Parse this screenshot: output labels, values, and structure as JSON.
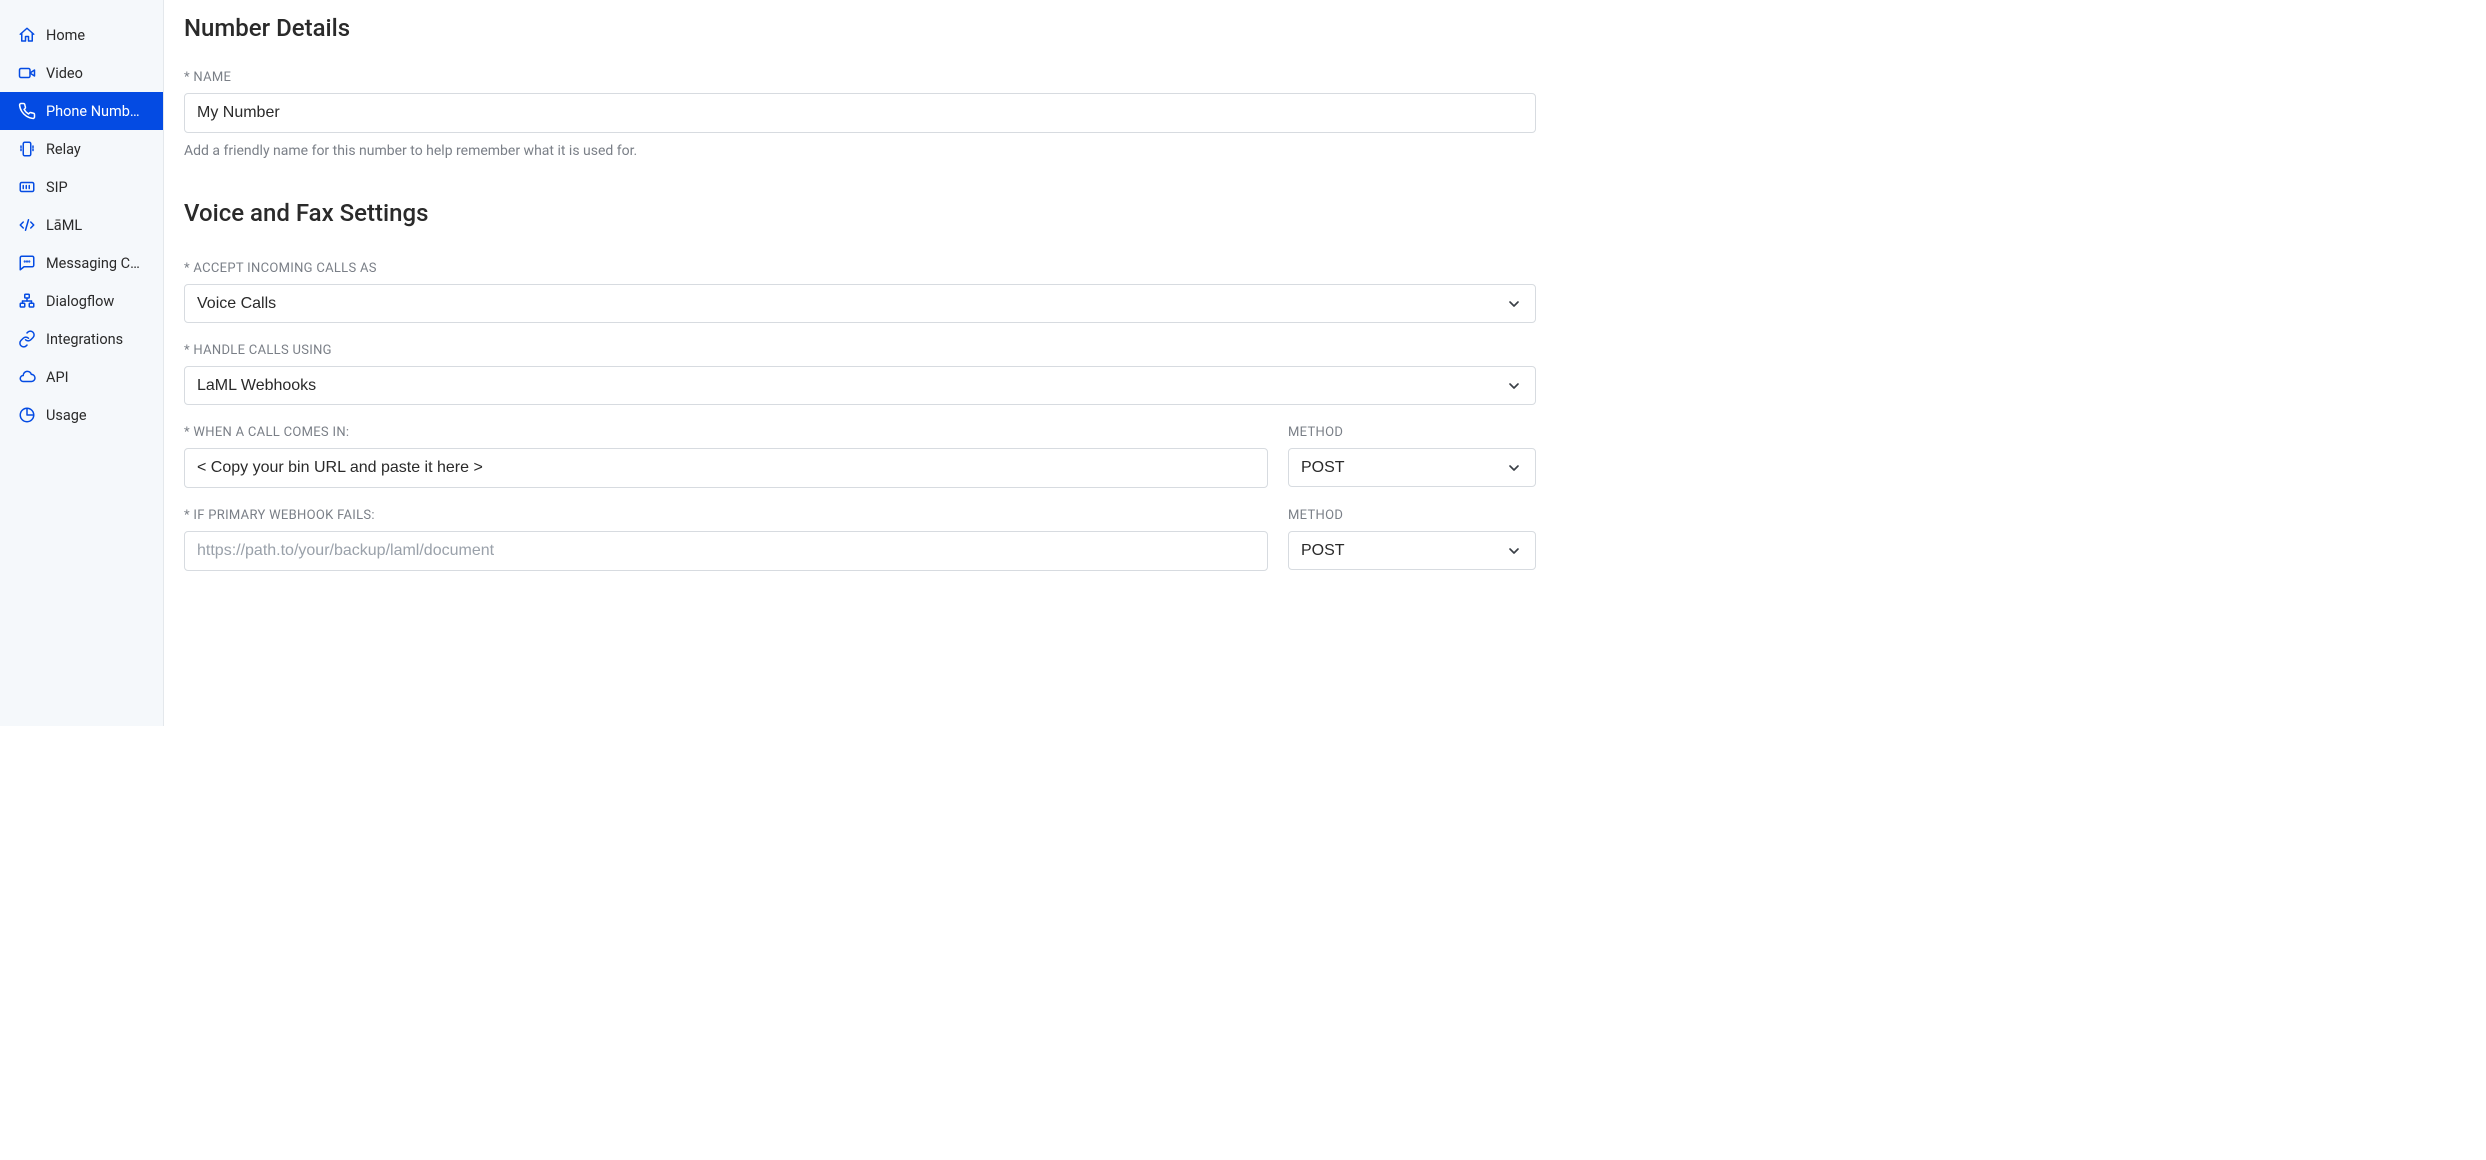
{
  "sidebar": {
    "items": [
      {
        "label": "Home"
      },
      {
        "label": "Video"
      },
      {
        "label": "Phone Numbers"
      },
      {
        "label": "Relay"
      },
      {
        "label": "SIP"
      },
      {
        "label": "LāML"
      },
      {
        "label": "Messaging Camp..."
      },
      {
        "label": "Dialogflow"
      },
      {
        "label": "Integrations"
      },
      {
        "label": "API"
      },
      {
        "label": "Usage"
      }
    ]
  },
  "section_number_details": {
    "title": "Number Details",
    "name_label": "* NAME",
    "name_value": "My Number",
    "name_help": "Add a friendly name for this number to help remember what it is used for."
  },
  "section_voice_fax": {
    "title": "Voice and Fax Settings",
    "accept_incoming_label": "* ACCEPT INCOMING CALLS AS",
    "accept_incoming_value": "Voice Calls",
    "handle_calls_label": "* HANDLE CALLS USING",
    "handle_calls_value": "LaML Webhooks",
    "when_call_label": "* WHEN A CALL COMES IN:",
    "when_call_value": "< Copy your bin URL and paste it here >",
    "when_call_method_label": "METHOD",
    "when_call_method_value": "POST",
    "fallback_label": "* IF PRIMARY WEBHOOK FAILS:",
    "fallback_placeholder": "https://path.to/your/backup/laml/document",
    "fallback_method_label": "METHOD",
    "fallback_method_value": "POST"
  }
}
